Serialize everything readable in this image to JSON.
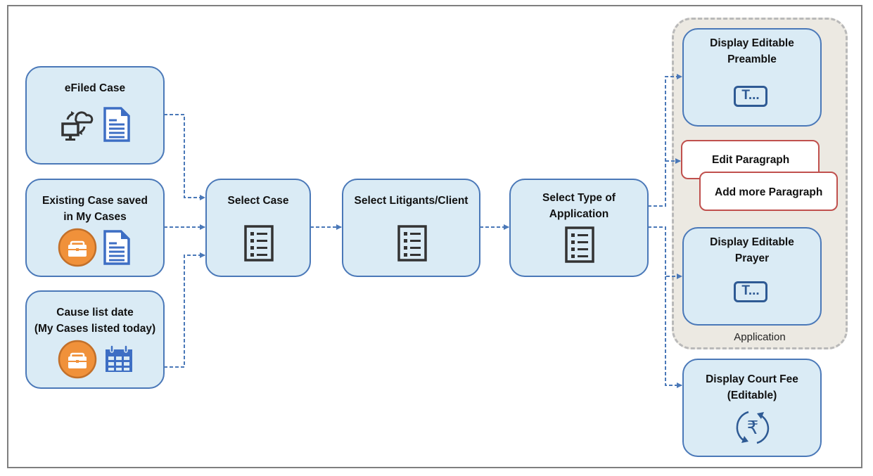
{
  "diagram": {
    "sources": [
      {
        "id": "efiled",
        "title_lines": [
          "eFiled Case"
        ],
        "icons": [
          "cloud-sync-computer-icon",
          "document-icon"
        ]
      },
      {
        "id": "existing",
        "title_lines": [
          "Existing Case saved",
          "in My Cases"
        ],
        "icons": [
          "briefcase-icon",
          "document-icon"
        ]
      },
      {
        "id": "causelist",
        "title_lines": [
          "Cause list date",
          "(My Cases listed today)"
        ],
        "icons": [
          "briefcase-icon",
          "calendar-icon"
        ]
      }
    ],
    "steps": [
      {
        "id": "select-case",
        "title_lines": [
          "Select  Case"
        ],
        "icon": "list-icon"
      },
      {
        "id": "select-litigants",
        "title_lines": [
          "Select  Litigants/Client"
        ],
        "icon": "list-icon"
      },
      {
        "id": "select-type",
        "title_lines": [
          "Select Type of",
          "Application"
        ],
        "icon": "list-icon"
      }
    ],
    "application_group": {
      "label": "Application",
      "preamble": {
        "title_lines": [
          "Display Editable",
          "Preamble"
        ],
        "icon": "text-field-icon",
        "icon_text": "T..."
      },
      "edit_paragraph": "Edit Paragraph",
      "add_paragraph": "Add more Paragraph",
      "prayer": {
        "title_lines": [
          "Display Editable",
          "Prayer"
        ],
        "icon": "text-field-icon",
        "icon_text": "T..."
      }
    },
    "court_fee": {
      "title_lines": [
        "Display  Court Fee",
        "(Editable)"
      ],
      "icon": "rupee-refresh-icon",
      "icon_text": "₹"
    }
  },
  "colors": {
    "node_fill": "#daebf5",
    "node_border": "#4a78b8",
    "connector": "#4a78b8",
    "paragraph_border": "#c0504d",
    "group_fill": "#ece9e2",
    "group_border": "#b9b9b9",
    "briefcase": "#f0913a",
    "doc_blue": "#3d6ec4",
    "icon_dark": "#333333"
  }
}
